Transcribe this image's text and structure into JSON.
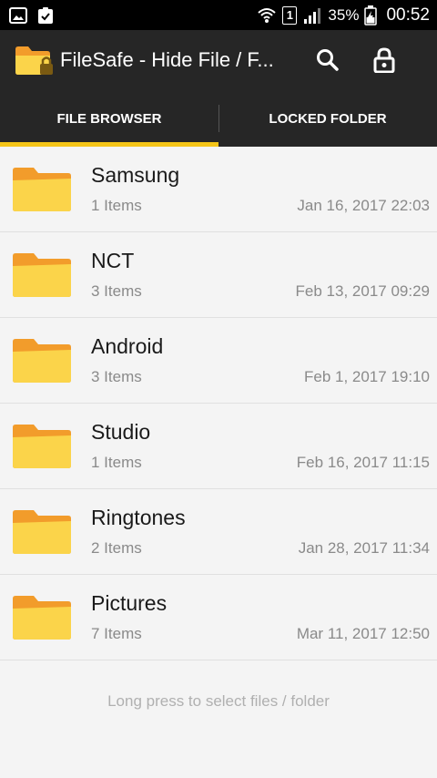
{
  "status_bar": {
    "battery_percent": "35%",
    "time": "00:52",
    "sim_slot": "1"
  },
  "app_bar": {
    "title": "FileSafe - Hide File / F...",
    "actions": [
      "search-icon",
      "lock-icon"
    ]
  },
  "tabs": [
    {
      "label": "FILE BROWSER",
      "active": true
    },
    {
      "label": "LOCKED FOLDER",
      "active": false
    }
  ],
  "folders": [
    {
      "name": "Samsung",
      "count": "1 Items",
      "date": "Jan 16, 2017 22:03"
    },
    {
      "name": "NCT",
      "count": "3 Items",
      "date": "Feb 13, 2017 09:29"
    },
    {
      "name": "Android",
      "count": "3 Items",
      "date": "Feb 1, 2017 19:10"
    },
    {
      "name": "Studio",
      "count": "1 Items",
      "date": "Feb 16, 2017 11:15"
    },
    {
      "name": "Ringtones",
      "count": "2 Items",
      "date": "Jan 28, 2017 11:34"
    },
    {
      "name": "Pictures",
      "count": "7 Items",
      "date": "Mar 11, 2017 12:50"
    }
  ],
  "hint": "Long press to select files / folder",
  "colors": {
    "accent": "#f5c518",
    "folder_front": "#fbd44a",
    "folder_back": "#f29c2b",
    "app_bar": "#262626"
  }
}
